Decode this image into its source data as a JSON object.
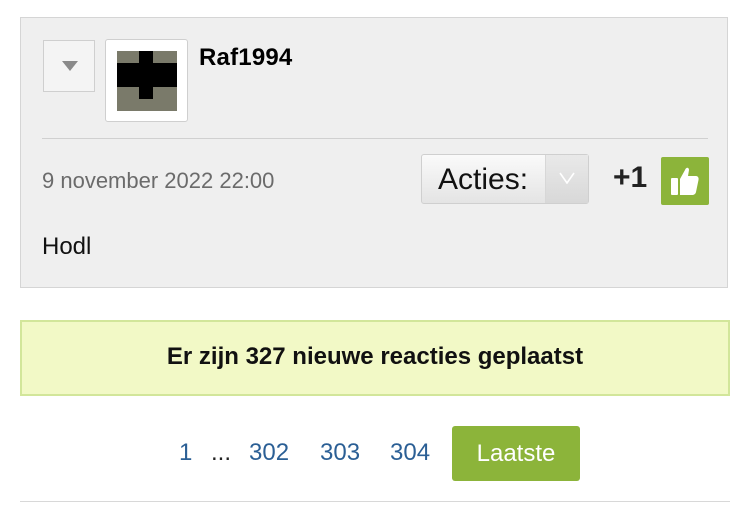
{
  "post": {
    "username": "Raf1994",
    "timestamp": "9 november 2022 22:00",
    "actions_label": "Acties:",
    "like_count": "+1",
    "body": "Hodl",
    "icons": {
      "toggle": "caret-down-icon",
      "actions_arrow": "chevron-down-icon",
      "like": "thumbs-up-icon"
    }
  },
  "notice": {
    "text": "Er zijn 327 nieuwe reacties geplaatst"
  },
  "pagination": {
    "first": "1",
    "ellipsis": "...",
    "pages": [
      "302",
      "303",
      "304"
    ],
    "last_label": "Laatste"
  },
  "colors": {
    "accent_green": "#8cb43a",
    "notice_bg": "#f2f9c6",
    "link_blue": "#2b5f95",
    "card_bg": "#efefef"
  }
}
